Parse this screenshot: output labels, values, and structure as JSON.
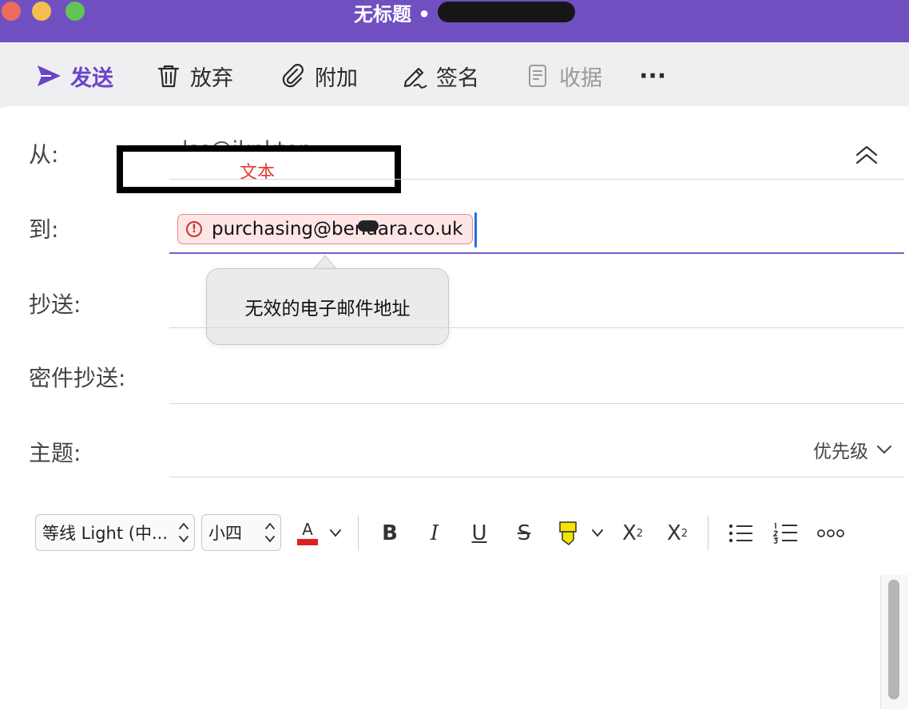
{
  "window": {
    "title": "无标题 •"
  },
  "toolbar": {
    "send": "发送",
    "discard": "放弃",
    "attach": "附加",
    "sign": "签名",
    "receipt": "收据",
    "more": "···"
  },
  "fields": {
    "from_label": "从:",
    "from_value": "lss@iknktop",
    "to_label": "到:",
    "cc_label": "抄送:",
    "bcc_label": "密件抄送:",
    "subject_label": "主题:"
  },
  "annotation": {
    "text": "文本"
  },
  "recipient": {
    "address": "purchasing@bendara.co.uk",
    "error_glyph": "!",
    "error_tooltip": "无效的电子邮件地址"
  },
  "priority": {
    "label": "优先级"
  },
  "format": {
    "font": "等线 Light (中...",
    "size": "小四",
    "color_glyph": "A",
    "bold": "B",
    "italic": "I",
    "underline": "U",
    "strike": "S",
    "superscript_base": "X",
    "superscript_mark": "2",
    "subscript_base": "X",
    "subscript_mark": "2"
  },
  "colors": {
    "accent": "#7050c0",
    "error": "#d32f2f",
    "font_color": "#e02020",
    "highlight": "#f5e400"
  }
}
